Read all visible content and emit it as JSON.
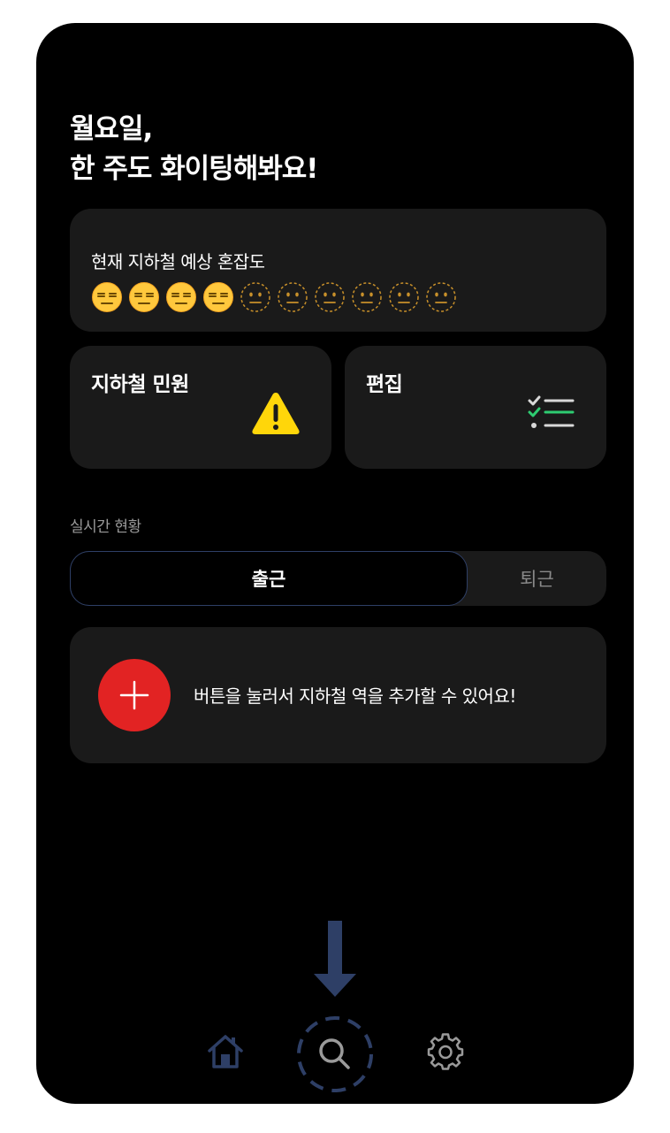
{
  "greeting": {
    "line1": "월요일,",
    "line2": "한 주도 화이팅해봐요!"
  },
  "congestion": {
    "title": "현재 지하철 예상 혼잡도",
    "level": 4,
    "max_level": 10,
    "filled_icon": "expressionless-face-icon",
    "empty_icon": "dotted-line-face-icon"
  },
  "complaint_card": {
    "title": "지하철 민원",
    "icon": "warning-icon"
  },
  "edit_card": {
    "title": "편집",
    "icon": "checklist-icon"
  },
  "realtime": {
    "label": "실시간 현황",
    "tabs": [
      {
        "label": "출근",
        "active": true
      },
      {
        "label": "퇴근",
        "active": false
      }
    ]
  },
  "add_station": {
    "message": "버튼을 눌러서 지하철 역을 추가할 수 있어요!",
    "button_icon": "plus-icon"
  },
  "bottom_nav": {
    "items": [
      {
        "name": "home-icon"
      },
      {
        "name": "search-icon",
        "highlighted": true
      },
      {
        "name": "gear-icon"
      }
    ]
  },
  "colors": {
    "background": "#000000",
    "card": "#1a1a1a",
    "accent_red": "#e22323",
    "nav_blue": "#2e3f66",
    "check_green": "#2ecc71",
    "warning_yellow": "#ffd60a"
  }
}
